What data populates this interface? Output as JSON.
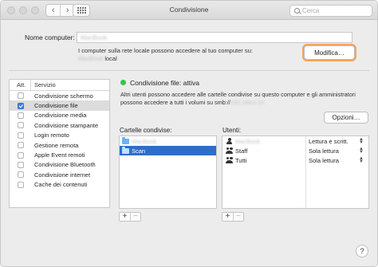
{
  "window": {
    "title": "Condivisione"
  },
  "search": {
    "placeholder": "Cerca"
  },
  "computer_name": {
    "label": "Nome computer:",
    "value": "MacBook",
    "desc_line1": "I computer sulla rete locale possono accedere al tuo computer su:",
    "desc_host": "MacBook",
    "desc_suffix": " local",
    "modify_label": "Modifica…"
  },
  "services": {
    "header_on": "Att.",
    "header_name": "Servizio",
    "items": [
      {
        "label": "Condivisione schermo",
        "checked": false,
        "selected": false
      },
      {
        "label": "Condivisione file",
        "checked": true,
        "selected": true
      },
      {
        "label": "Condivisione media",
        "checked": false,
        "selected": false
      },
      {
        "label": "Condivisione stampante",
        "checked": false,
        "selected": false
      },
      {
        "label": "Login remoto",
        "checked": false,
        "selected": false
      },
      {
        "label": "Gestione remota",
        "checked": false,
        "selected": false
      },
      {
        "label": "Apple Event remoti",
        "checked": false,
        "selected": false
      },
      {
        "label": "Condivisione Bluetooth",
        "checked": false,
        "selected": false
      },
      {
        "label": "Condivisione internet",
        "checked": false,
        "selected": false
      },
      {
        "label": "Cache dei contenuti",
        "checked": false,
        "selected": false
      }
    ]
  },
  "status": {
    "title": "Condivisione file: attiva",
    "color": "#34c64a",
    "desc": "Altri utenti possono accedere alle cartelle condivise su questo computer e gli amministratori possono accedere a tutti i volumi su smb://",
    "desc_host": "192.168.0.10",
    "options_label": "Opzioni…"
  },
  "folders": {
    "label": "Cartelle condivise:",
    "items": [
      {
        "name": "MacBook",
        "selected": false,
        "blurred": true
      },
      {
        "name": "Scan",
        "selected": true,
        "blurred": false
      }
    ]
  },
  "users": {
    "label": "Utenti:",
    "items": [
      {
        "name": "MacBook",
        "permission": "Lettura e scritt.",
        "blurred": true,
        "icon": "single-user-icon"
      },
      {
        "name": "Staff",
        "permission": "Sola lettura",
        "blurred": false,
        "icon": "group-icon"
      },
      {
        "name": "Tutti",
        "permission": "Sola lettura",
        "blurred": false,
        "icon": "group-icon"
      }
    ]
  },
  "buttons": {
    "plus": "+",
    "minus": "−",
    "help": "?"
  },
  "colors": {
    "accent": "#f5a35b",
    "selection": "#2f6dc9",
    "checkbox": "#3f84e5"
  }
}
